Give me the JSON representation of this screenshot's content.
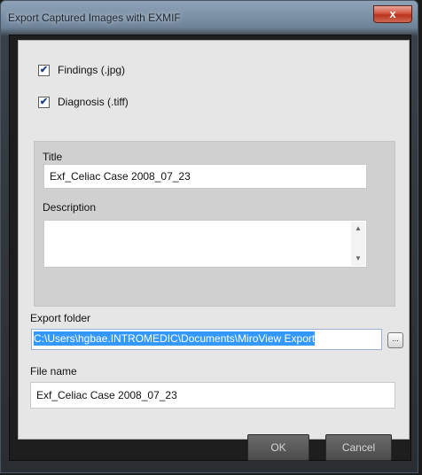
{
  "window": {
    "title": "Export Captured Images with EXMIF",
    "close_symbol": "x"
  },
  "checkboxes": [
    {
      "label": "Findings (.jpg)",
      "checked": true,
      "check_mark": "✔"
    },
    {
      "label": "Diagnosis (.tiff)",
      "checked": true,
      "check_mark": "✔"
    }
  ],
  "title_field": {
    "label": "Title",
    "value": "Exf_Celiac Case 2008_07_23"
  },
  "description_field": {
    "label": "Description",
    "value": ""
  },
  "export_folder": {
    "label": "Export folder",
    "value": "C:\\Users\\hgbae.INTROMEDIC\\Documents\\MiroView Export",
    "browse_label": "..."
  },
  "file_name": {
    "label": "File name",
    "value": "Exf_Celiac Case 2008_07_23"
  },
  "buttons": {
    "ok": "OK",
    "cancel": "Cancel"
  },
  "icons": {
    "scroll_up": "▲",
    "scroll_down": "▼"
  }
}
